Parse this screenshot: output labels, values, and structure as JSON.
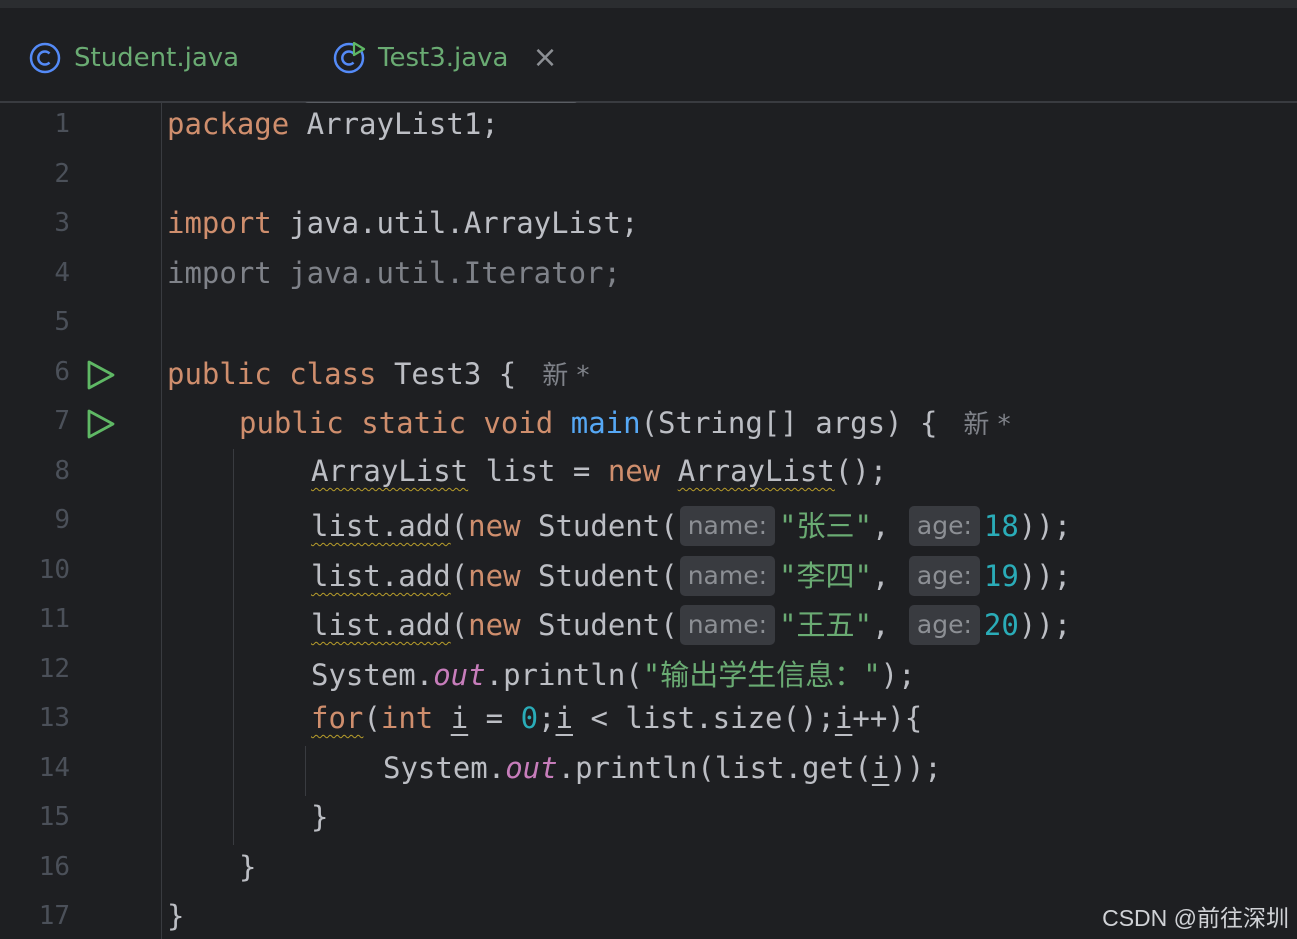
{
  "tabs": [
    {
      "label": "Student.java",
      "icon": "java-class-icon",
      "active": false
    },
    {
      "label": "Test3.java",
      "icon": "java-runnable-class-icon",
      "active": true,
      "close": "×"
    }
  ],
  "colors": {
    "keyword": "#cf8e6d",
    "function": "#56a8f5",
    "string": "#6aab73",
    "number": "#2aacb8",
    "field": "#c77dbb",
    "text": "#bcbec4",
    "background": "#1e1f22"
  },
  "line_numbers": [
    "1",
    "2",
    "3",
    "4",
    "5",
    "6",
    "7",
    "8",
    "9",
    "10",
    "11",
    "12",
    "13",
    "14",
    "15",
    "16",
    "17"
  ],
  "code": {
    "l1_kw": "package",
    "l1_rest": " ArrayList1;",
    "l3_kw": "import",
    "l3_rest": " java.util.ArrayList;",
    "l4": "import java.util.Iterator;",
    "l6_kw": "public class",
    "l6_rest": " Test3 {",
    "l7_kw": "public static void",
    "l7_fn": "main",
    "l7_rest": "(String[] args) {",
    "l8_type": "ArrayList",
    "l8_mid": " list = ",
    "l8_new": "new",
    "l8_ctor": "ArrayList",
    "l8_end": "();",
    "list_add": "list.add",
    "paren_open": "(",
    "new_kw": "new",
    "student": " Student(",
    "hint_name": "name:",
    "hint_age": "age:",
    "comma": ",",
    "close": "));",
    "l9_str": "\"张三\"",
    "l9_num": "18",
    "l10_str": "\"李四\"",
    "l10_num": "19",
    "l11_str": "\"王五\"",
    "l11_num": "20",
    "sys": "System.",
    "out": "out",
    "println": ".println(",
    "l12_str": "\"输出学生信息：\"",
    "l12_end": ");",
    "l13_for": "for",
    "l13_int": "int",
    "l13_i": "i",
    "l13_eq": " = ",
    "l13_zero": "0",
    "l13_size": " < list.size();",
    "l13_inc": "++){",
    "l14_get": "list.get(",
    "l14_end": "));",
    "brace_close": "}"
  },
  "new_marker": "新 *",
  "watermark": "CSDN @前往深圳"
}
